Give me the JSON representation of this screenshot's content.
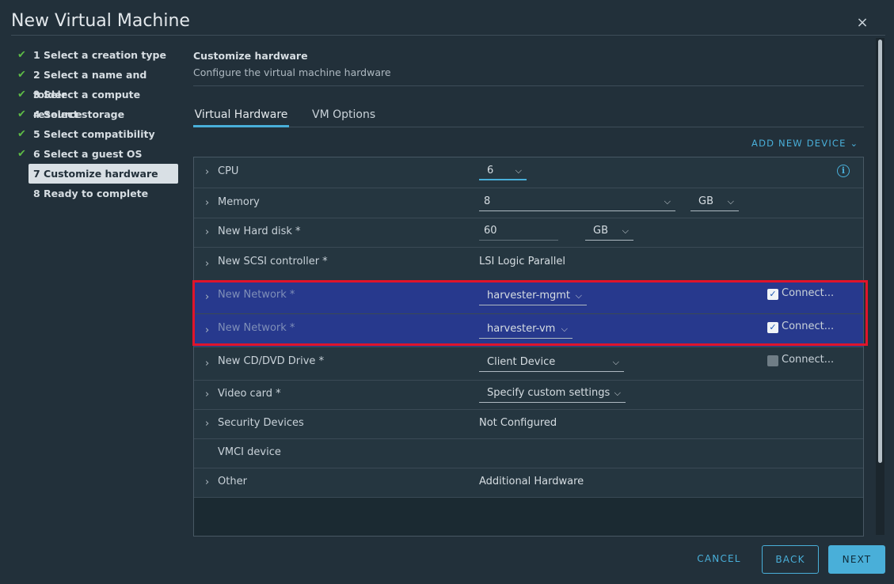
{
  "dialog": {
    "title": "New Virtual Machine",
    "close_glyph": "×"
  },
  "steps": [
    {
      "label": "1 Select a creation type",
      "done": true
    },
    {
      "label": "2 Select a name and folder",
      "done": true
    },
    {
      "label": "3 Select a compute resource",
      "done": true
    },
    {
      "label": "4 Select storage",
      "done": true
    },
    {
      "label": "5 Select compatibility",
      "done": true
    },
    {
      "label": "6 Select a guest OS",
      "done": true
    },
    {
      "label": "7 Customize hardware",
      "active": true
    },
    {
      "label": "8 Ready to complete"
    }
  ],
  "header": {
    "title": "Customize hardware",
    "subtitle": "Configure the virtual machine hardware"
  },
  "tabs": [
    {
      "label": "Virtual Hardware",
      "selected": true
    },
    {
      "label": "VM Options"
    }
  ],
  "add_device_label": "ADD NEW DEVICE",
  "hardware": {
    "cpu": {
      "label": "CPU",
      "value": "6"
    },
    "memory": {
      "label": "Memory",
      "value": "8",
      "unit": "GB"
    },
    "disk": {
      "label": "New Hard disk *",
      "value": "60",
      "unit": "GB"
    },
    "scsi": {
      "label": "New SCSI controller *",
      "value": "LSI Logic Parallel"
    },
    "network1": {
      "label": "New Network *",
      "value": "harvester-mgmt",
      "connect_label": "Connect...",
      "connected": true
    },
    "network2": {
      "label": "New Network *",
      "value": "harvester-vm",
      "connect_label": "Connect...",
      "connected": true
    },
    "cdrom": {
      "label": "New CD/DVD Drive *",
      "value": "Client Device",
      "connect_label": "Connect...",
      "connected": false
    },
    "video": {
      "label": "Video card *",
      "value": "Specify custom settings"
    },
    "security": {
      "label": "Security Devices",
      "value": "Not Configured"
    },
    "vmci": {
      "label": "VMCI device"
    },
    "other": {
      "label": "Other",
      "value": "Additional Hardware"
    }
  },
  "footer": {
    "cancel": "CANCEL",
    "back": "BACK",
    "next": "NEXT"
  },
  "colors": {
    "accent": "#49afd9",
    "highlight": "#e0142b",
    "check": "#5dbb46",
    "selected_row": "#27398d"
  }
}
